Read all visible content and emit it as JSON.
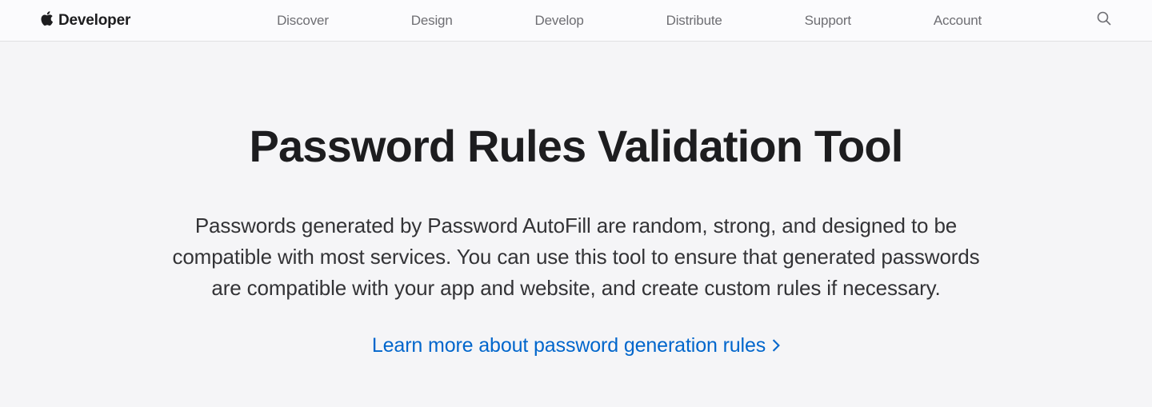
{
  "nav": {
    "brand": "Developer",
    "links": [
      "Discover",
      "Design",
      "Develop",
      "Distribute",
      "Support",
      "Account"
    ]
  },
  "main": {
    "title": "Password Rules Validation Tool",
    "description": "Passwords generated by Password AutoFill are random, strong, and designed to be compatible with most services. You can use this tool to ensure that generated passwords are compatible with your app and website, and create custom rules if necessary.",
    "learn_more": "Learn more about password generation rules"
  }
}
